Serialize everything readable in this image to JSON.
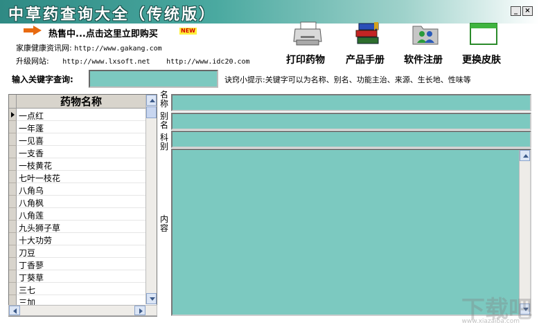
{
  "window": {
    "title": "中草药查询大全（传统版）",
    "minimize_label": "_",
    "close_label": "×"
  },
  "promo": {
    "text": "热售中...点击这里立即购买",
    "badge": "NEW"
  },
  "info": {
    "site_label": "家康健康资讯网:",
    "site_url": "http://www.gakang.com",
    "upgrade_label": "升级网站:",
    "upgrade_url_1": "http://www.lxsoft.net",
    "upgrade_url_2": "http://www.idc20.com"
  },
  "toolbar": [
    {
      "label": "打印药物",
      "icon": "printer-icon"
    },
    {
      "label": "产品手册",
      "icon": "books-icon"
    },
    {
      "label": "软件注册",
      "icon": "users-folder-icon"
    },
    {
      "label": "更换皮肤",
      "icon": "window-icon"
    }
  ],
  "search": {
    "label": "输入关键字查询:",
    "value": "",
    "hint": "诀窍小提示:关键字可以为名称、别名、功能主治、来源、生长地、性味等"
  },
  "list": {
    "header": "药物名称",
    "items": [
      "一点红",
      "一年蓬",
      "一见喜",
      "一支香",
      "一枝黄花",
      "七叶一枝花",
      "八角乌",
      "八角枫",
      "八角莲",
      "九头狮子草",
      "十大功劳",
      "刀豆",
      "丁香蓼",
      "丁葵草",
      "三七",
      "三加"
    ]
  },
  "fields": {
    "name_label": "名称",
    "alias_label": "别名",
    "family_label": "科别",
    "content_label": "内容",
    "name_value": "",
    "alias_value": "",
    "family_value": "",
    "content_value": ""
  },
  "watermark": {
    "main": "下载吧",
    "sub": "www.xiazaiba.com"
  },
  "colors": {
    "field_bg": "#7cc9c0",
    "title_gradient_start": "#2f8a84",
    "promo_arrow": "#e86a10"
  }
}
